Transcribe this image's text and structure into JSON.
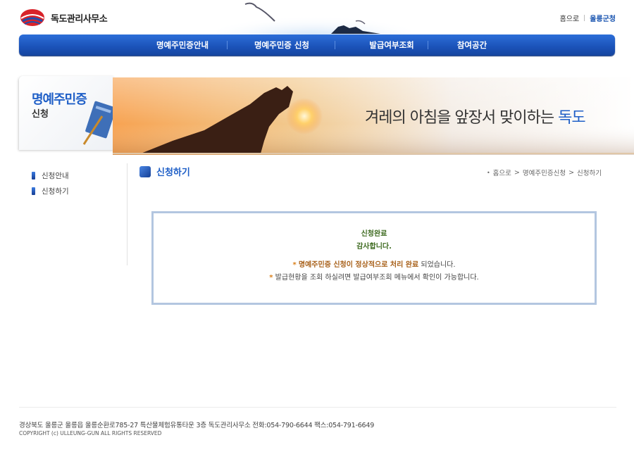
{
  "header": {
    "logo_text": "독도관리사무소",
    "home_link": "홈으로",
    "gun_link": "울릉군청"
  },
  "gnb": {
    "items": [
      "명예주민증안내",
      "명예주민증 신청",
      "발급여부조회",
      "참여공간"
    ]
  },
  "visual": {
    "side_title_1": "명예주민증",
    "side_title_2": "신청",
    "slogan_prefix": "겨레의 아침을 앞장서 맞이하는 ",
    "slogan_accent": "독도"
  },
  "lnb": {
    "items": [
      "신청안내",
      "신청하기"
    ]
  },
  "content": {
    "title": "신청하기",
    "breadcrumb": {
      "bullet": "•",
      "home": "홈으로",
      "sep": ">",
      "level1": "명예주민증신청",
      "level2": "신청하기"
    },
    "result": {
      "line1": "신청완료",
      "line2": "감사합니다.",
      "line3_star": "*",
      "line3_hl": "명예주민증 신청이 정상적으로 처리 완료",
      "line3_rest": " 되었습니다.",
      "line4_star": "*",
      "line4_text": "발급현황을 조회 하실려면 발급여부조회 메뉴에서 확인이 가능합니다."
    }
  },
  "footer": {
    "address": "경상북도 울릉군 울릉읍 울릉순환로785-27 특산물체험유통타운 3층 독도관리사무소   전화:054-790-6644   팩스:054-791-6649",
    "copyright": "COPYRIGHT (c) ULLEUNG-GUN ALL RIGHTS RESERVED"
  },
  "colors": {
    "brand_blue": "#1f5fc7",
    "nav_blue": "#1b52b8",
    "success_green": "#3d6a1f",
    "highlight_orange": "#a8611a",
    "box_border": "#b3c6e0"
  }
}
